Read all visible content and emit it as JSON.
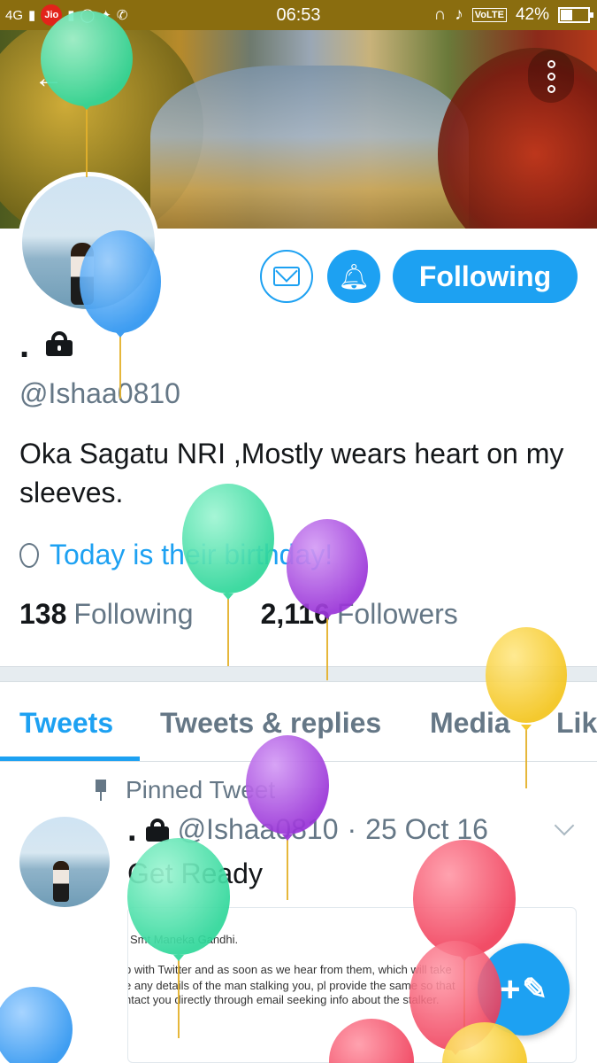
{
  "status_bar": {
    "network": "4G",
    "carrier_badge": "Jio",
    "time": "06:53",
    "volte": "VoLTE",
    "battery_percent": "42%",
    "battery_level": 0.42
  },
  "header": {
    "back_icon": "arrow-left-icon",
    "menu_icon": "more-vertical-icon"
  },
  "profile": {
    "display_name": ".",
    "handle": "@Ishaa0810",
    "bio": "Oka Sagatu NRI ,Mostly wears heart on my sleeves.",
    "birthday_text": "Today is their birthday!",
    "following_count": "138",
    "following_label": "Following",
    "followers_count": "2,116",
    "followers_label": "Followers"
  },
  "actions": {
    "message_icon": "mail-icon",
    "notifications_icon": "bell-check-icon",
    "follow_state_label": "Following"
  },
  "tabs": [
    {
      "label": "Tweets",
      "active": true
    },
    {
      "label": "Tweets & replies",
      "active": false
    },
    {
      "label": "Media",
      "active": false
    },
    {
      "label": "Lik",
      "active": false
    }
  ],
  "pinned_tweet": {
    "pinned_label": "Pinned Tweet",
    "name": ".",
    "handle": "@Ishaa0810",
    "separator": "·",
    "date": "25 Oct 16",
    "text": "Get Ready",
    "media_lines": [
      "Smt Maneka Gandhi.",
      "p with Twitter and as soon as we hear from them, which will take",
      "e any details of the man stalking you, pl provide the same so that",
      "ntact you directly through email seeking info about the stalker."
    ]
  },
  "compose_button": {
    "label": "+",
    "icon": "feather-icon"
  },
  "colors": {
    "accent": "#1da1f2",
    "status_bar": "#8a6d0f",
    "secondary_text": "#657786"
  }
}
